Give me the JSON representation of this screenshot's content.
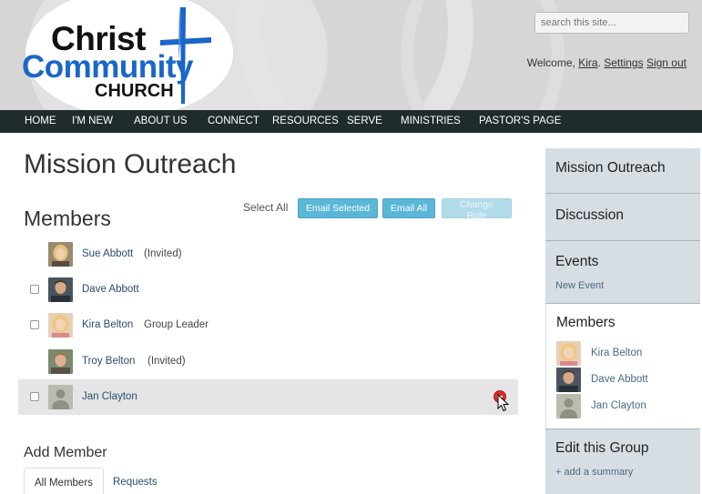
{
  "header": {
    "logo": {
      "line1": "Christ",
      "line2": "Community",
      "line3": "CHURCH"
    },
    "search_placeholder": "search this site...",
    "welcome_text": "Welcome,",
    "user_name": "Kira",
    "settings_label": "Settings",
    "signout_label": "Sign out"
  },
  "nav": [
    "HOME",
    "I'M NEW",
    "ABOUT US",
    "CONNECT",
    "RESOURCES",
    "SERVE",
    "MINISTRIES",
    "PASTOR'S PAGE"
  ],
  "main": {
    "title": "Mission Outreach",
    "members_heading": "Members",
    "select_all": "Select All",
    "buttons": {
      "email_selected": "Email Selected",
      "email_all": "Email All",
      "change_role": "Change Role"
    },
    "members": [
      {
        "name": "Sue Abbott",
        "role": "(Invited)",
        "checkbox": false
      },
      {
        "name": "Dave Abbott",
        "role": "",
        "checkbox": true
      },
      {
        "name": "Kira Belton",
        "role": "Group Leader",
        "checkbox": true
      },
      {
        "name": "Troy Belton",
        "role": "(Invited)",
        "checkbox": false
      },
      {
        "name": "Jan Clayton",
        "role": "",
        "checkbox": true
      }
    ],
    "add_member_heading": "Add Member",
    "tabs": [
      "All Members",
      "Requests"
    ]
  },
  "sidebar": {
    "group_name": "Mission Outreach",
    "discussion": "Discussion",
    "events": "Events",
    "new_event": "New Event",
    "members": "Members",
    "member_list": [
      "Kira Belton",
      "Dave Abbott",
      "Jan Clayton"
    ],
    "edit_group": "Edit this Group",
    "add_summary": "+ add a summary"
  },
  "colors": {
    "nav_bg": "#1f2b2c",
    "button": "#5bb7d8",
    "link": "#2a4d6e",
    "logo_blue": "#1a66c9",
    "sidebar_bg": "#d6dde3"
  }
}
